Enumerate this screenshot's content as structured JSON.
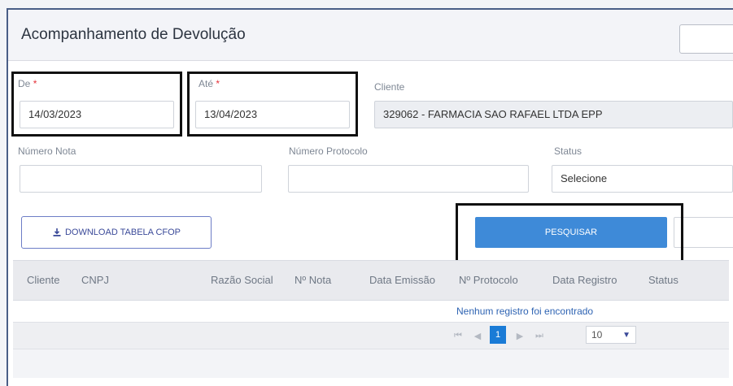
{
  "header": {
    "title": "Acompanhamento de Devolução"
  },
  "filters": {
    "de": {
      "label": "De",
      "required_mark": "*",
      "value": "14/03/2023"
    },
    "ate": {
      "label": "Até",
      "required_mark": "*",
      "value": "13/04/2023"
    },
    "cliente": {
      "label": "Cliente",
      "value": "329062 - FARMACIA SAO RAFAEL LTDA EPP"
    },
    "numero_nota": {
      "label": "Número Nota",
      "value": ""
    },
    "numero_protocolo": {
      "label": "Número Protocolo",
      "value": ""
    },
    "status": {
      "label": "Status",
      "value": "Selecione"
    }
  },
  "actions": {
    "download_label": "DOWNLOAD TABELA CFOP",
    "search_label": "PESQUISAR"
  },
  "table": {
    "columns": [
      "Cliente",
      "CNPJ",
      "Razão Social",
      "Nº Nota",
      "Data Emissão",
      "Nº Protocolo",
      "Data Registro",
      "Status"
    ],
    "empty_message": "Nenhum registro foi encontrado"
  },
  "pager": {
    "current_page": "1",
    "page_size": "10"
  },
  "colors": {
    "primary": "#3e8ad8",
    "active_page": "#1a7bd6",
    "required": "#e5333a",
    "link_text": "#2f64b3"
  }
}
